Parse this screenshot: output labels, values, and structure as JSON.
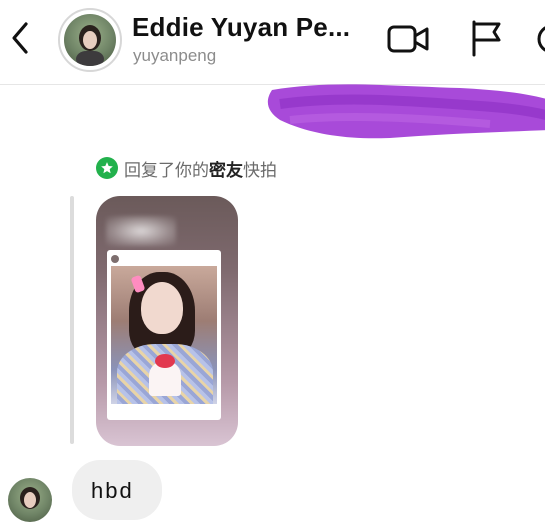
{
  "header": {
    "name": "Eddie Yuyan Pe...",
    "username": "yuyanpeng",
    "icons": [
      "back-chevron-icon",
      "video-call-icon",
      "flag-icon",
      "info-icon"
    ]
  },
  "reply": {
    "prefix": "回复了你的",
    "bold": "密友",
    "suffix": "快拍"
  },
  "message": {
    "text": "hbd"
  },
  "colors": {
    "accent_green": "#22b14c",
    "scribble_purple": "#a13bd6",
    "bubble_bg": "#efefef"
  }
}
